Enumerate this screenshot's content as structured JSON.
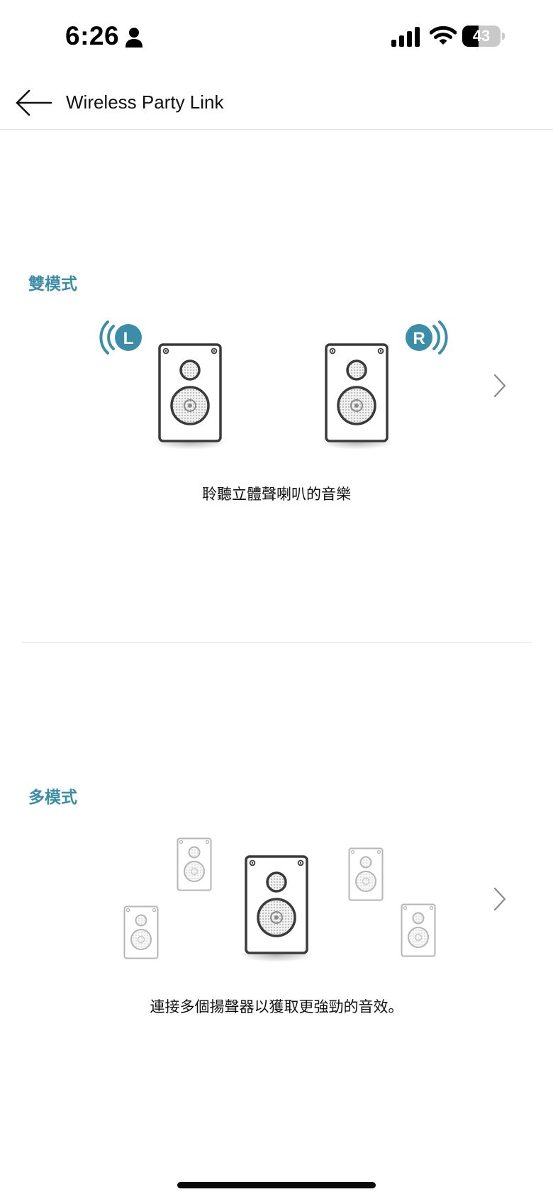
{
  "status_bar": {
    "time": "6:26",
    "battery_level": "43",
    "icons": [
      "person-icon",
      "cellular-signal-icon",
      "wifi-icon",
      "battery-icon"
    ]
  },
  "header": {
    "title": "Wireless Party Link",
    "back_icon": "arrow-left-icon"
  },
  "dual_mode": {
    "label": "雙模式",
    "left_badge": "L",
    "right_badge": "R",
    "description": "聆聽立體聲喇叭的音樂",
    "chevron_icon": "chevron-right-icon"
  },
  "multi_mode": {
    "label": "多模式",
    "description": "連接多個揚聲器以獲取更強勁的音效。",
    "chevron_icon": "chevron-right-icon"
  },
  "colors": {
    "accent": "#3c8ea8",
    "speaker_stroke": "#3a3a3a",
    "speaker_faded_stroke": "#b5b5b5",
    "divider": "#e3e3e3"
  }
}
